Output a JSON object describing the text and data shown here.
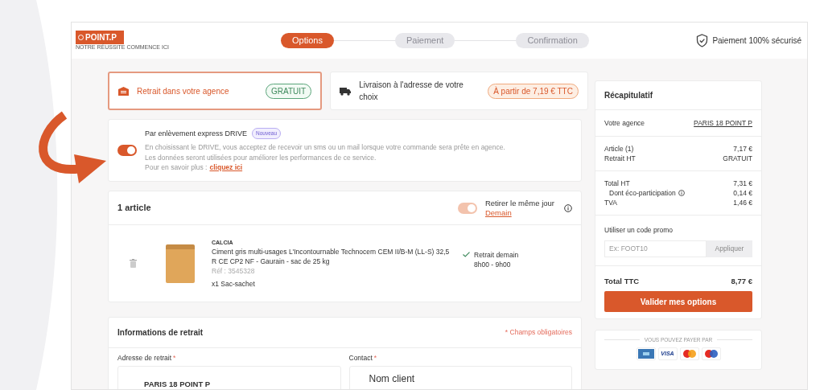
{
  "header": {
    "logo": "POINT.P",
    "tagline": "NOTRE RÉUSSITE COMMENCE ICI",
    "secure": "Paiement 100% sécurisé"
  },
  "steps": [
    {
      "label": "Options",
      "selected": true
    },
    {
      "label": "Paiement",
      "selected": false
    },
    {
      "label": "Confirmation",
      "selected": false
    }
  ],
  "delivery_options": [
    {
      "kind": "pickup",
      "label": "Retrait dans votre agence",
      "badge": "GRATUIT",
      "selected": true
    },
    {
      "kind": "delivery",
      "label": "Livraison à l'adresse de votre choix",
      "badge": "À partir de 7,19 € TTC",
      "selected": false
    }
  ],
  "drive": {
    "title": "Par enlèvement express DRIVE",
    "badge": "Nouveau",
    "on": true,
    "lines": [
      "En choisissant le DRIVE, vous acceptez de recevoir un sms ou un mail lorsque votre commande sera prête en agence.",
      "Les données seront utilisées pour améliorer les performances de ce service."
    ],
    "more_prefix": "Pour en savoir plus :",
    "more_link": "cliquez ici"
  },
  "article": {
    "heading": "1 article",
    "same_day": {
      "label": "Retirer le même jour",
      "link": "Demain",
      "on": true,
      "disabled": true
    },
    "item": {
      "brand": "CALCIA",
      "name": "Ciment gris multi-usages L'Incontournable Technocem CEM II/B-M (LL-S) 32,5 R CE CP2 NF - Gaurain - sac de 25 kg",
      "ref": "Réf : 3545328",
      "quantity": "x1 Sac-sachet",
      "availability": "Retrait demain",
      "hours": "8h00 - 9h00"
    }
  },
  "info": {
    "title": "Informations de retrait",
    "required_note": "* Champs obligatoires",
    "fields": [
      {
        "label": "Adresse de retrait",
        "mark": "*",
        "value": "PARIS 18 POINT P",
        "kind": "address"
      },
      {
        "label": "Contact",
        "mark": "*",
        "value": "Nom client",
        "kind": "contact"
      }
    ]
  },
  "summary": {
    "title": "Récapitulatif",
    "agency_label": "Votre agence",
    "agency": "PARIS 18 POINT P",
    "groups": [
      [
        {
          "label": "Article (1)",
          "value": "7,17 €"
        },
        {
          "label": "Retrait HT",
          "value": "GRATUIT"
        }
      ],
      [
        {
          "label": "Total HT",
          "value": "7,31 €"
        },
        {
          "label": "Dont éco-participation",
          "value": "0,14 €",
          "kind": "sub"
        },
        {
          "label": "TVA",
          "value": "1,46 €"
        }
      ]
    ],
    "promo_label": "Utiliser un code promo",
    "promo_placeholder": "Ex: FOOT10",
    "promo_button": "Appliquer",
    "total_label": "Total TTC",
    "total": "8,77 €",
    "cta": "Valider mes options"
  },
  "payment": {
    "label": "VOUS POUVEZ PAYER PAR",
    "cards": [
      {
        "kind": "cb"
      },
      {
        "kind": "visa",
        "text": "VISA"
      },
      {
        "kind": "mastercard"
      },
      {
        "kind": "maestro"
      }
    ]
  }
}
